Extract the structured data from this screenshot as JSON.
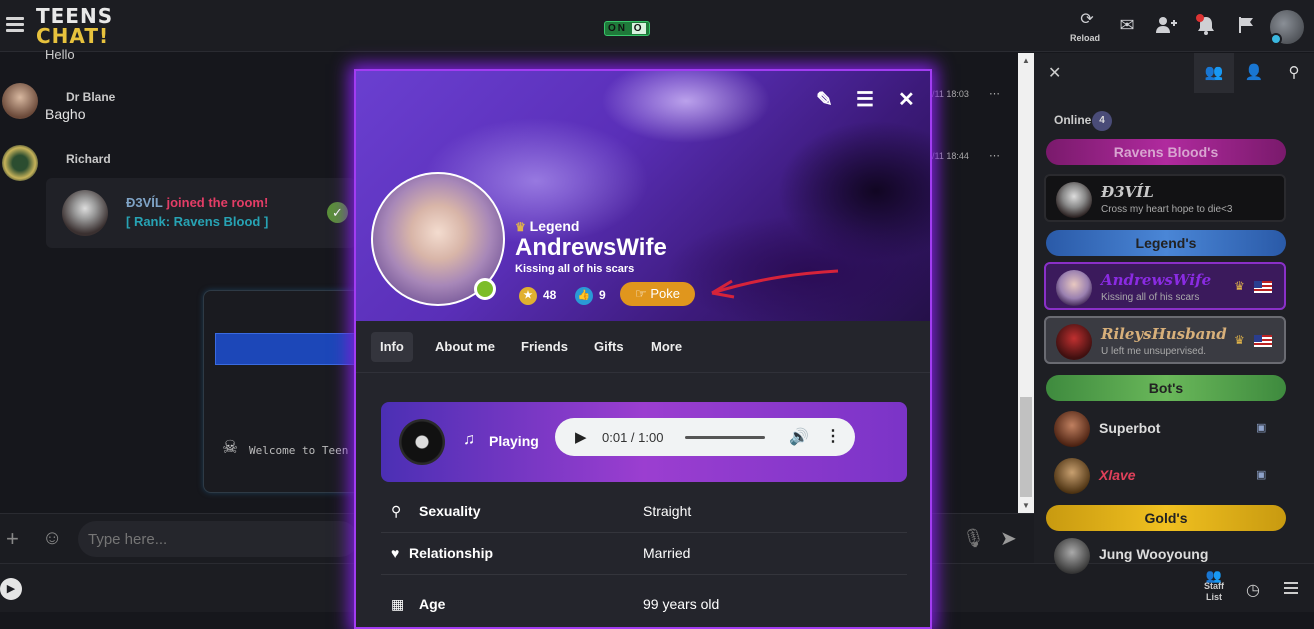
{
  "app": {
    "logo_line1": "TEENS",
    "logo_line2": "CHAT!",
    "onoff": "ON",
    "onoff_off": "O",
    "reload_label": "Reload"
  },
  "chat": {
    "partial_message": "Hello",
    "messages": [
      {
        "name": "Dr Blane",
        "text": "Bagho",
        "time": "/11 18:03"
      },
      {
        "name": "Richard",
        "text": "",
        "time": "/11 18:44"
      }
    ],
    "system": {
      "user": "Ð3VÍL",
      "joined": "joined the room!",
      "rank": "[ Rank: Ravens Blood ]"
    },
    "bot_welcome": "Welcome to Teen"
  },
  "input": {
    "placeholder": "Type here..."
  },
  "footer": {
    "staff_label_1": "Staff",
    "staff_label_2": "List"
  },
  "right_panel": {
    "online_label": "Online",
    "online_count": "4",
    "ranks": {
      "ravens": "Ravens Blood's",
      "legends": "Legend's",
      "bots": "Bot's",
      "gold": "Gold's"
    },
    "users": [
      {
        "name": "Ð3VÍL",
        "mood": "Cross my heart hope to die<3"
      },
      {
        "name": "AndrewsWife",
        "mood": "Kissing all of his scars"
      },
      {
        "name": "RileysHusband",
        "mood": "U left me unsupervised."
      },
      {
        "name": "Superbot"
      },
      {
        "name": "Xlave"
      },
      {
        "name": "Jung Wooyoung"
      }
    ]
  },
  "profile": {
    "rank": "Legend",
    "name": "AndrewsWife",
    "mood": "Kissing all of his scars",
    "stars": "48",
    "likes": "9",
    "poke": "Poke",
    "tabs": [
      "Info",
      "About me",
      "Friends",
      "Gifts",
      "More"
    ],
    "player": {
      "label": "Playing",
      "time": "0:01 / 1:00"
    },
    "info": [
      {
        "key": "Sexuality",
        "value": "Straight"
      },
      {
        "key": "Relationship",
        "value": "Married"
      },
      {
        "key": "Age",
        "value": "99 years old"
      }
    ]
  }
}
